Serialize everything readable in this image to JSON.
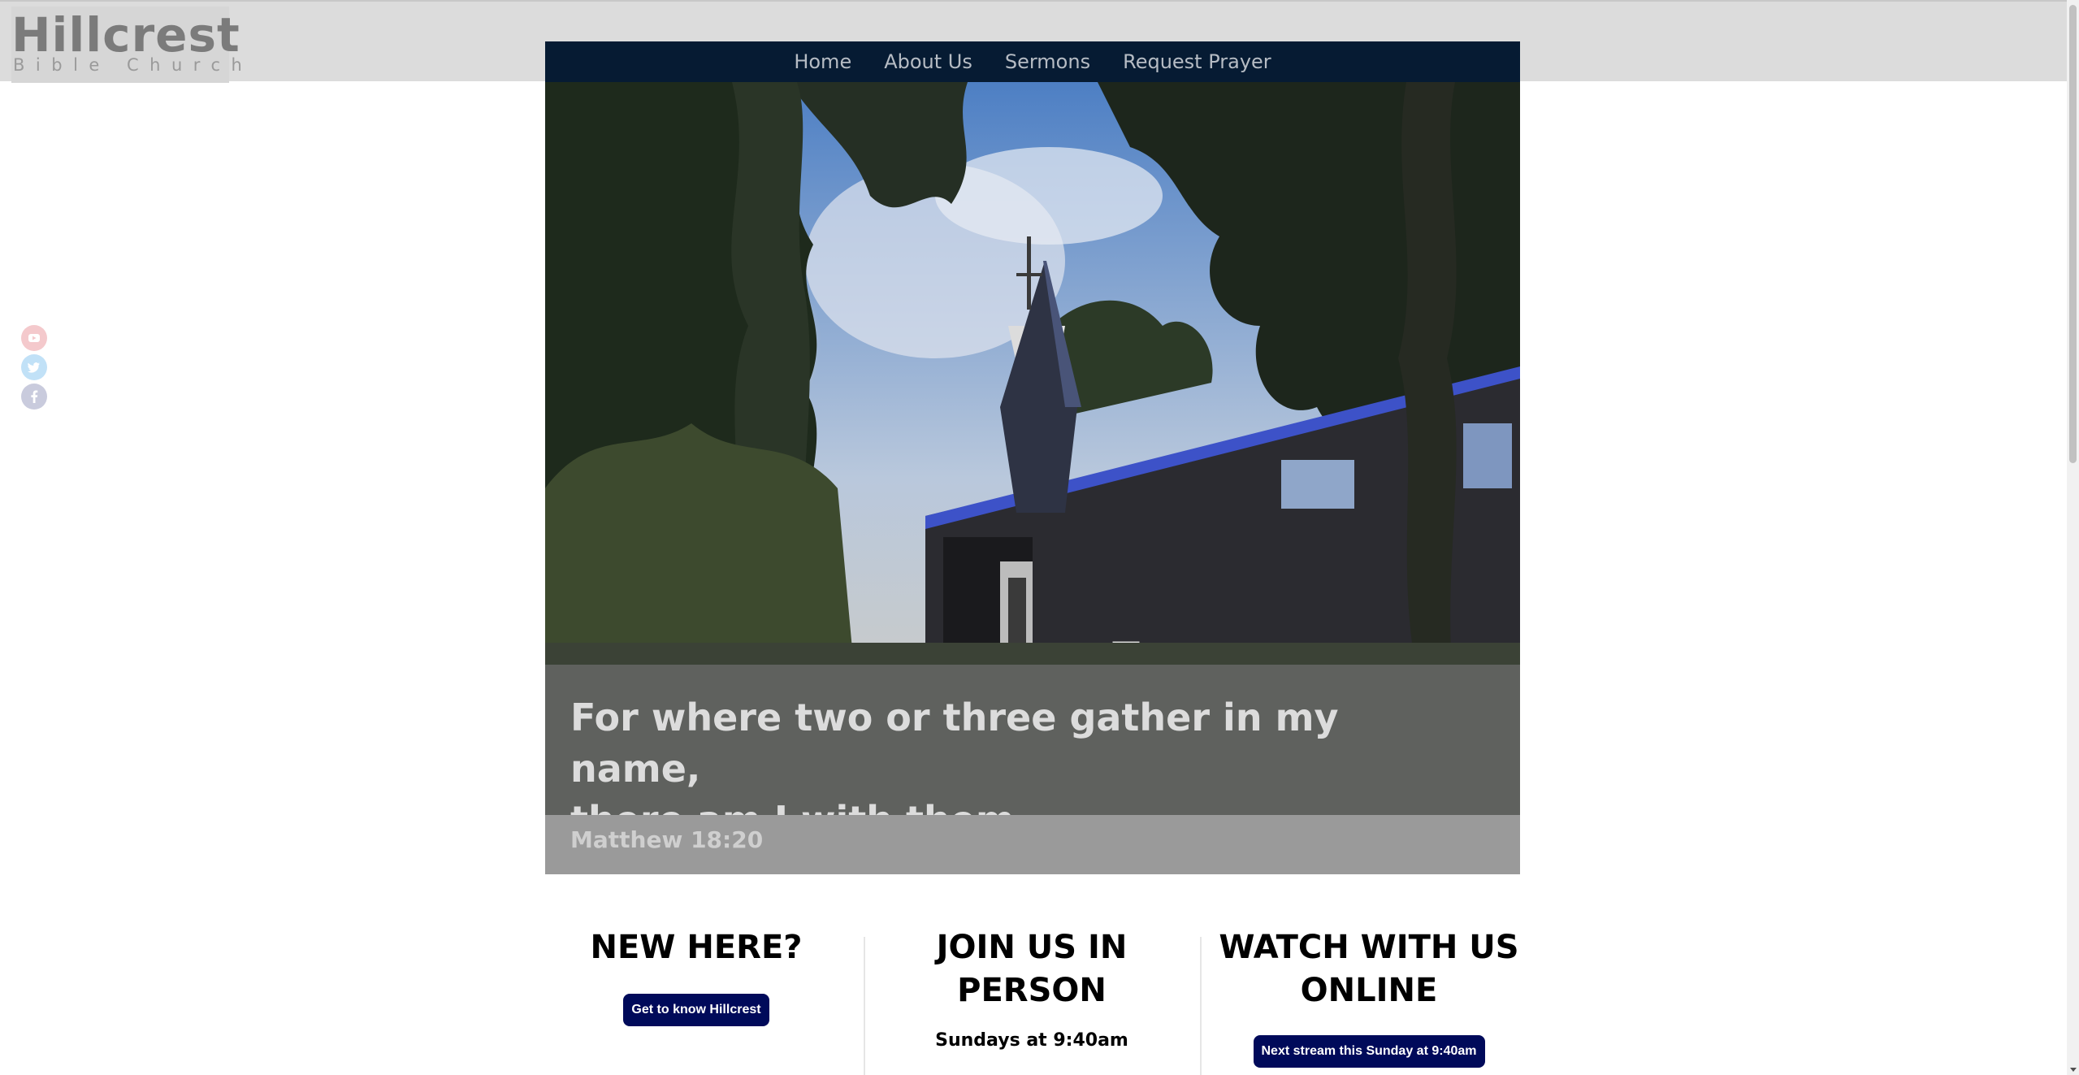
{
  "logo": {
    "name": "Hillcrest",
    "subtitle": "Bible Church"
  },
  "nav": {
    "items": [
      "Home",
      "About Us",
      "Sermons",
      "Request Prayer"
    ]
  },
  "social": [
    {
      "icon": "youtube-icon",
      "color": "#f4c9cc"
    },
    {
      "icon": "twitter-icon",
      "color": "#c1e1f7"
    },
    {
      "icon": "facebook-icon",
      "color": "#c9cbdd"
    }
  ],
  "hero": {
    "verse_line1": "For where two or three gather in my name,",
    "verse_line2": "there am I with them.",
    "reference": "Matthew 18:20"
  },
  "sections": {
    "new_here": {
      "title": "NEW HERE?",
      "button": "Get to know Hillcrest"
    },
    "join": {
      "title_line1": "JOIN US IN",
      "title_line2": "PERSON",
      "time": "Sundays at 9:40am"
    },
    "watch": {
      "title_line1": "WATCH WITH US",
      "title_line2": "ONLINE",
      "button": "Next stream this Sunday at 9:40am"
    }
  },
  "colors": {
    "nav_bg": "#061b33",
    "button_bg": "#000a5a",
    "topbar_bg": "#dcdcdc"
  }
}
